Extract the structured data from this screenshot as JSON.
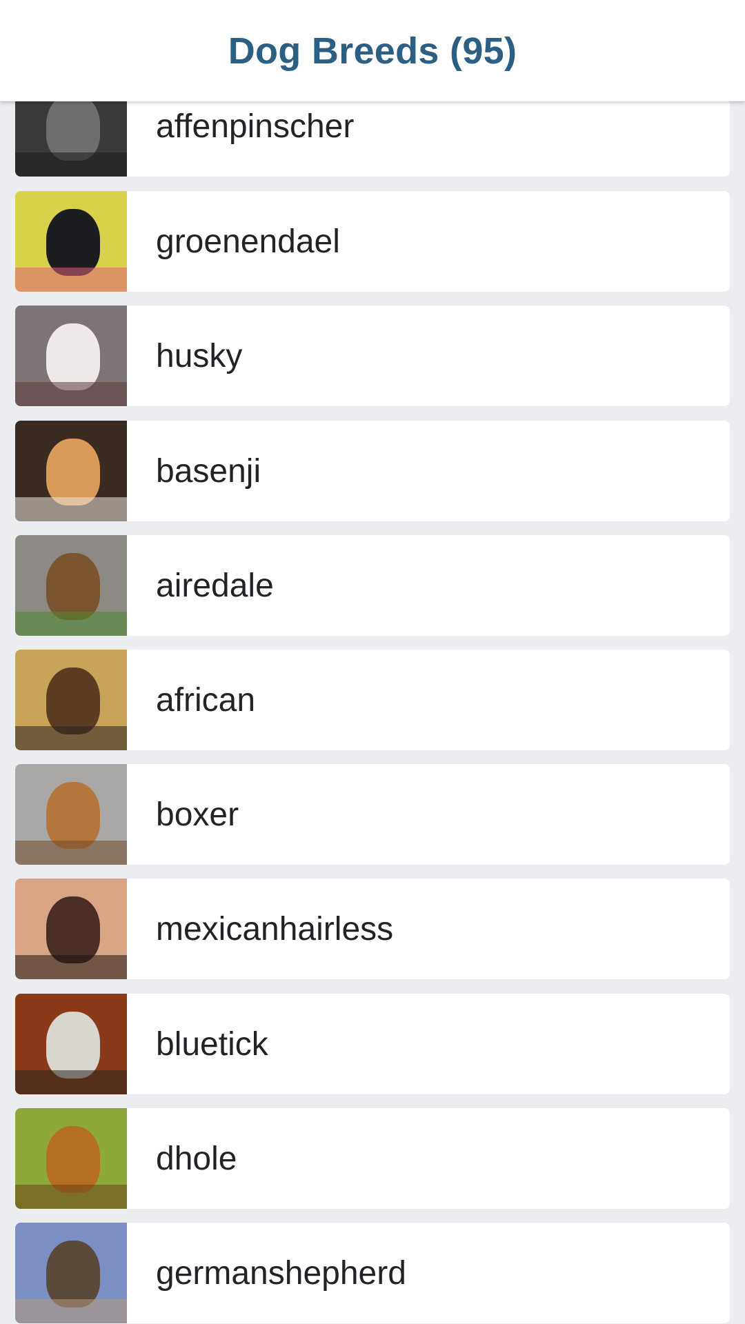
{
  "header": {
    "title": "Dog Breeds (95)"
  },
  "breeds": [
    {
      "name": "affenpinscher",
      "photo": "black-shaggy-dog-photo",
      "colors": [
        "#3a3a3a",
        "#6e6e6e",
        "#1c1c1c"
      ]
    },
    {
      "name": "groenendael",
      "photo": "black-shepherd-photo",
      "colors": [
        "#d8d24a",
        "#1b1d20",
        "#e0607a"
      ]
    },
    {
      "name": "husky",
      "photo": "husky-on-gravel-photo",
      "colors": [
        "#7d7478",
        "#efe9ea",
        "#5b3a3a"
      ]
    },
    {
      "name": "basenji",
      "photo": "basenji-with-puppies-photo",
      "colors": [
        "#3a2b22",
        "#d99a5a",
        "#e9e4dd"
      ]
    },
    {
      "name": "airedale",
      "photo": "airedale-on-grass-photo",
      "colors": [
        "#8d8a86",
        "#7a5530",
        "#4f8a2e"
      ]
    },
    {
      "name": "african",
      "photo": "african-wild-dog-photo",
      "colors": [
        "#caa35a",
        "#5a3d22",
        "#2a2520"
      ]
    },
    {
      "name": "boxer",
      "photo": "boxer-puppy-photo",
      "colors": [
        "#a9a8a6",
        "#b5763d",
        "#6f4a2a"
      ]
    },
    {
      "name": "mexicanhairless",
      "photo": "woman-with-hairless-dogs-photo",
      "colors": [
        "#d9a585",
        "#4a2e25",
        "#1b1512"
      ]
    },
    {
      "name": "bluetick",
      "photo": "bluetick-hound-photo",
      "colors": [
        "#8a3a18",
        "#d9d5cf",
        "#2a2421"
      ]
    },
    {
      "name": "dhole",
      "photo": "dhole-on-grass-photo",
      "colors": [
        "#8ea83a",
        "#b56f22",
        "#6a4018"
      ]
    },
    {
      "name": "germanshepherd",
      "photo": "german-shepherd-photo",
      "colors": [
        "#7b8fc4",
        "#5a4a3a",
        "#b69a7a"
      ]
    }
  ]
}
